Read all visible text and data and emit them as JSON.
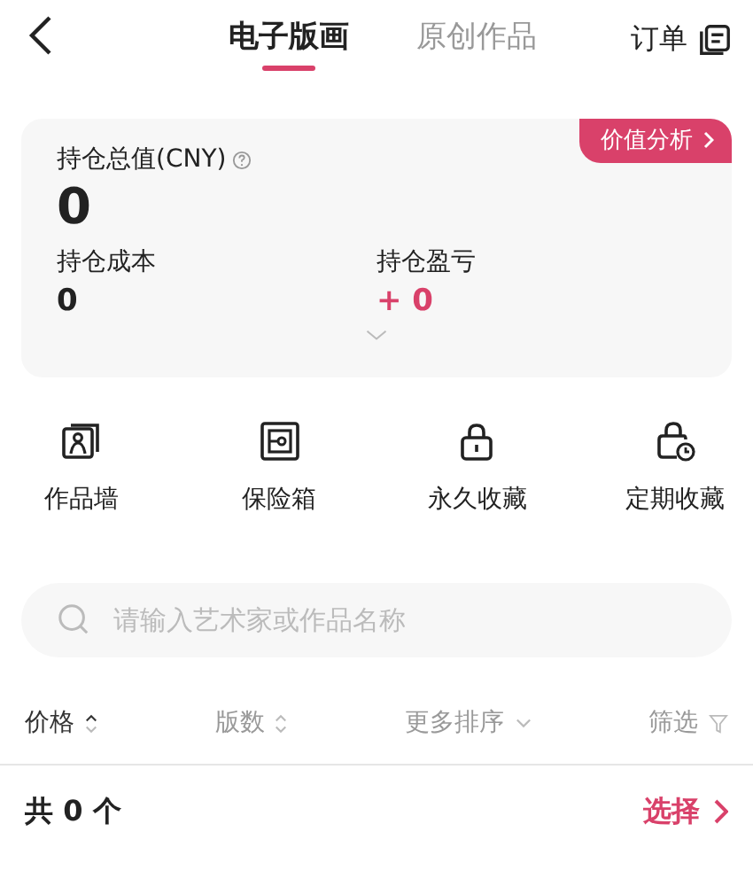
{
  "header": {
    "tabs": [
      {
        "label": "电子版画",
        "selected": true
      },
      {
        "label": "原创作品",
        "selected": false
      }
    ],
    "orders": "订单"
  },
  "summary": {
    "badge": "价值分析",
    "total_label": "持仓总值(CNY)",
    "total": "0",
    "cost_label": "持仓成本",
    "cost": "0",
    "pnl_label": "持仓盈亏",
    "pnl": "+ 0"
  },
  "shortcuts": [
    {
      "kind": "wall",
      "label": "作品墙"
    },
    {
      "kind": "safe",
      "label": "保险箱"
    },
    {
      "kind": "lock",
      "label": "永久收藏"
    },
    {
      "kind": "timed-lock",
      "label": "定期收藏"
    }
  ],
  "search": {
    "placeholder": "请输入艺术家或作品名称"
  },
  "sort": [
    {
      "kind": "updown",
      "label": "价格",
      "selected": true
    },
    {
      "kind": "updown",
      "label": "版数",
      "selected": false
    },
    {
      "kind": "dropdown",
      "label": "更多排序",
      "selected": false
    },
    {
      "kind": "filter",
      "label": "筛选",
      "selected": false
    }
  ],
  "footer": {
    "count": "共 0 个",
    "select": "选择"
  }
}
